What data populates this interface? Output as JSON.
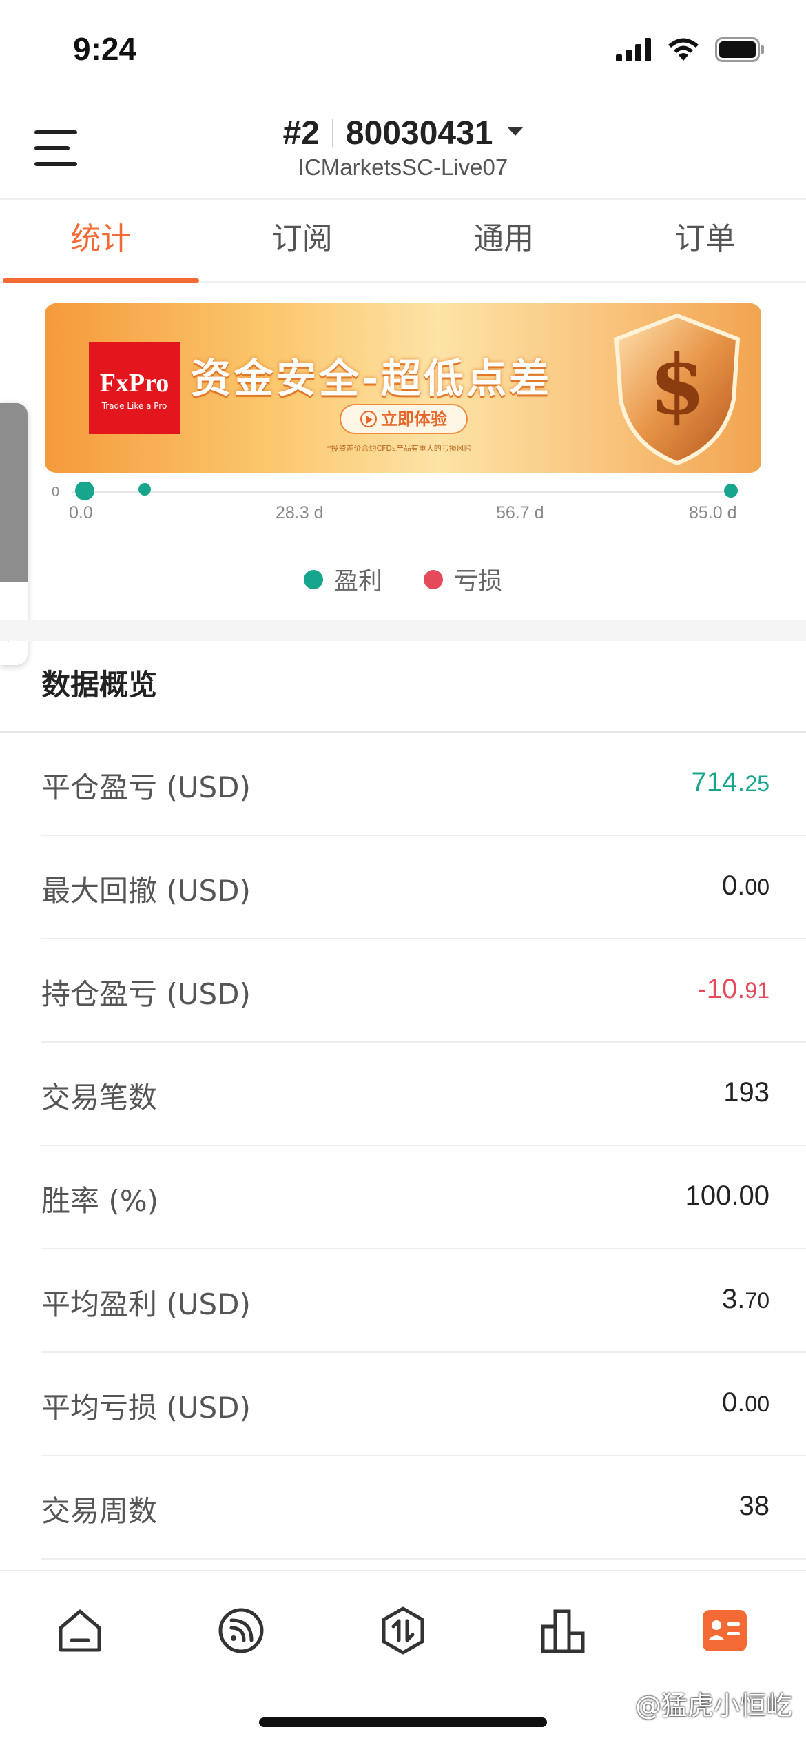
{
  "status_bar": {
    "time": "9:24"
  },
  "header": {
    "account_index": "#2",
    "account_number": "80030431",
    "server": "ICMarketsSC-Live07"
  },
  "tabs": [
    {
      "label": "统计",
      "active": true
    },
    {
      "label": "订阅",
      "active": false
    },
    {
      "label": "通用",
      "active": false
    },
    {
      "label": "订单",
      "active": false
    }
  ],
  "banner": {
    "logo_brand": "FxPro",
    "logo_tagline": "Trade Like a Pro",
    "headline": "资金安全-超低点差",
    "cta": "立即体验",
    "disclaimer": "*投资差价合约CFDs产品有重大的亏损风险"
  },
  "chart": {
    "y_tick": "0",
    "x_ticks": [
      "0.0",
      "28.3 d",
      "56.7 d",
      "85.0 d"
    ],
    "legend": [
      {
        "label": "盈利",
        "color": "#18a58e"
      },
      {
        "label": "亏损",
        "color": "#e44a5a"
      }
    ]
  },
  "overview": {
    "title": "数据概览",
    "rows": [
      {
        "label": "平仓盈亏 (USD)",
        "int": "714.",
        "dec": "25",
        "tone": "pos"
      },
      {
        "label": "最大回撤 (USD)",
        "int": "0.",
        "dec": "00",
        "tone": "neutral"
      },
      {
        "label": "持仓盈亏 (USD)",
        "int": "-10.",
        "dec": "91",
        "tone": "neg"
      },
      {
        "label": "交易笔数",
        "int": "193",
        "dec": "",
        "tone": "neutral"
      },
      {
        "label": "胜率 (%)",
        "int": "100.00",
        "dec": "",
        "tone": "neutral"
      },
      {
        "label": "平均盈利 (USD)",
        "int": "3.",
        "dec": "70",
        "tone": "neutral"
      },
      {
        "label": "平均亏损 (USD)",
        "int": "0.",
        "dec": "00",
        "tone": "neutral"
      },
      {
        "label": "交易周数",
        "int": "38",
        "dec": "",
        "tone": "neutral"
      }
    ]
  },
  "bottom_nav": {
    "items": [
      "home-icon",
      "feed-icon",
      "trade-icon",
      "chart-icon",
      "account-icon"
    ],
    "active": 4
  },
  "watermark": "@猛虎小恒屹",
  "colors": {
    "accent": "#f46a35",
    "profit": "#18a58e",
    "loss": "#e44a5a"
  }
}
